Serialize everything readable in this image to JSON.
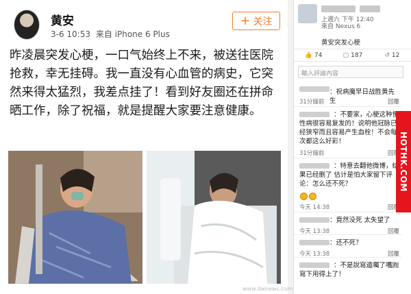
{
  "weibo": {
    "username": "黄安",
    "timestamp": "3-6 10:53",
    "source": "来自 iPhone 6 Plus",
    "follow_label": "关注",
    "post_text": "昨凌晨突发心梗，一口气始终上不来，被送往医院抢救，幸无挂碍。我一直没有心血管的病史，它突然来得太猛烈，我差点挂了！看到好友圈还在拼命晒工作，除了祝福，就是提醒大家要注意健康。"
  },
  "phone": {
    "time": "上週六 下午 12:40",
    "device": "來自 Nexus 6",
    "desc": "黄安突发心梗",
    "stats": {
      "likes": "74",
      "comments": "187",
      "reposts": "12"
    },
    "input_placeholder": "輸入評論內容",
    "comments": [
      {
        "text": "：祝病魔早日战胜黄先生",
        "time": "31分鐘前",
        "reply": "回覆"
      },
      {
        "text": "：不要家，心梗这种慢性病很容易复发的！说明他冠脉已经狭窄而且容易产生血栓！不会每次都这么好彩！",
        "time": "31分鐘前",
        "reply": "回覆"
      },
      {
        "text": "：特意去翻他微博，结果已经删了 估计是怕大家留下评论：怎么还不死？",
        "time": "今天 14:38",
        "reply": "回覆"
      },
      {
        "text": "：竟然没死 太失望了",
        "time": "今天 13:38",
        "reply": "回覆"
      },
      {
        "text": "：还不死？",
        "time": "今天 13:38",
        "reply": "回覆"
      },
      {
        "text": "：不是說寫遺囑了嗎？寫下用得上了！",
        "time": "",
        "reply": "回覆"
      }
    ]
  },
  "watermark": "HOTHK.COM",
  "site_watermark": "www.dwnews.com"
}
